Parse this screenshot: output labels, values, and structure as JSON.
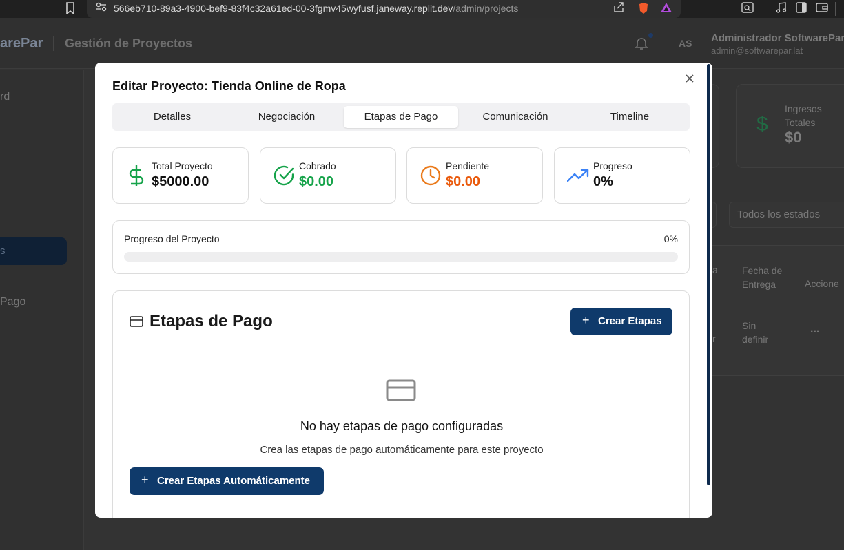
{
  "browser": {
    "url_host": "566eb710-89a3-4900-bef9-83f4c32a61ed-00-3fgmv45wyfusf.janeway.replit.dev",
    "url_path": "/admin/projects"
  },
  "app": {
    "brand": "arePar",
    "page_title": "Gestión de Proyectos",
    "user_initials": "AS",
    "user_name": "Administrador SoftwarePar",
    "user_email": "admin@softwarepar.lat",
    "sidebar": {
      "item_dashboard": "rd",
      "item_active": "s",
      "item_pago": "Pago"
    },
    "bg_card": {
      "label": "Ingresos Totales",
      "value": "$0"
    },
    "bg_filter": "Todos los estados",
    "bg_table": {
      "col_fecha": "Fecha de Entrega",
      "col_acciones": "Accione",
      "col_partial_a": "a",
      "row_fecha": "Sin definir",
      "row_partial": "r",
      "row_actions": "..."
    }
  },
  "modal": {
    "title": "Editar Proyecto: Tienda Online de Ropa",
    "close_label": "×",
    "tabs": [
      {
        "label": "Detalles"
      },
      {
        "label": "Negociación"
      },
      {
        "label": "Etapas de Pago"
      },
      {
        "label": "Comunicación"
      },
      {
        "label": "Timeline"
      }
    ],
    "active_tab": "Etapas de Pago",
    "stats": [
      {
        "label": "Total Proyecto",
        "value": "$5000.00",
        "icon": "dollar-icon",
        "color": "#16a34a",
        "value_color": "#111111"
      },
      {
        "label": "Cobrado",
        "value": "$0.00",
        "icon": "check-circle-icon",
        "color": "#16a34a",
        "value_color": "#16a34a"
      },
      {
        "label": "Pendiente",
        "value": "$0.00",
        "icon": "clock-icon",
        "color": "#ea7a1b",
        "value_color": "#ea5a0c"
      },
      {
        "label": "Progreso",
        "value": "0%",
        "icon": "trending-up-icon",
        "color": "#3b82f6",
        "value_color": "#111111"
      }
    ],
    "progress": {
      "label": "Progreso del Proyecto",
      "percent_text": "0%",
      "percent": 0
    },
    "stages": {
      "title": "Etapas de Pago",
      "create_button": "Crear Etapas",
      "empty_title": "No hay etapas de pago configuradas",
      "empty_subtitle": "Crea las etapas de pago automáticamente para este proyecto",
      "auto_button": "Crear Etapas Automáticamente"
    },
    "accent_color": "#0f3a6b"
  }
}
